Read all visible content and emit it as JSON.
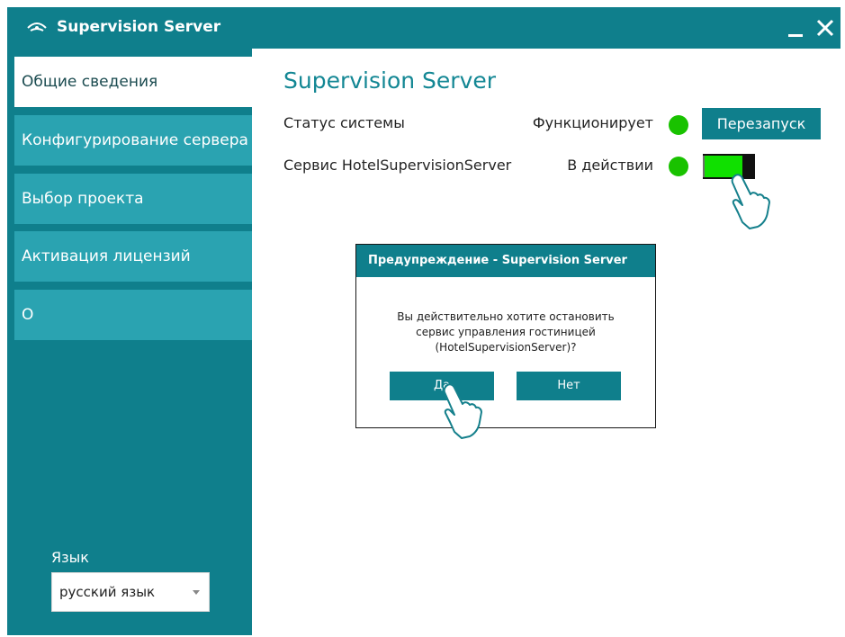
{
  "window": {
    "title": "Supervision Server",
    "accent_color": "#0f7f8c",
    "icons": {
      "app": "app-icon",
      "minimize": "minimize-icon",
      "close": "close-icon"
    }
  },
  "sidebar": {
    "items": [
      {
        "label": "Общие сведения",
        "active": true
      },
      {
        "label": "Конфигурирование сервера",
        "active": false
      },
      {
        "label": "Выбор проекта",
        "active": false
      },
      {
        "label": "Активация лицензий",
        "active": false
      },
      {
        "label": "О",
        "active": false
      }
    ],
    "language": {
      "label": "Язык",
      "selected": "русский язык",
      "dropdown_icon": "dropdown-arrow-icon"
    }
  },
  "main": {
    "title": "Supervision Server",
    "rows": [
      {
        "label": "Статус системы",
        "status": "Функционирует",
        "status_color": "#19c200",
        "button_label": "Перезапуск"
      },
      {
        "label": "Сервис HotelSupervisionServer",
        "status": "В действии",
        "status_color": "#19c200",
        "toggle_state": "on"
      }
    ]
  },
  "dialog": {
    "title": "Предупреждение - Supervision Server",
    "message_lines": [
      "Вы действительно хотите остановить",
      "сервис управления гостиницей",
      "(HotelSupervisionServer)?"
    ],
    "yes_label": "Да",
    "no_label": "Нет"
  },
  "cursors": [
    "hand-pointer-icon",
    "hand-pointer-icon"
  ]
}
